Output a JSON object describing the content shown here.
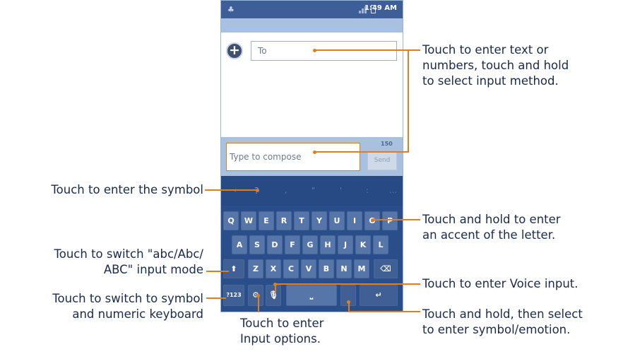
{
  "status_bar": {
    "time": "1:49 AM",
    "android_icon": "android-icon",
    "signal_icon": "signal-icon",
    "battery_icon": "battery-icon"
  },
  "recipient": {
    "add_icon": "add-contact-icon",
    "to_placeholder": "To"
  },
  "compose": {
    "placeholder": "Type to compose",
    "char_count": "150",
    "send_label": "Send"
  },
  "keyboard": {
    "symbol_row": [
      "←",
      "?",
      ",",
      "\"",
      "'",
      ":",
      "…"
    ],
    "row1": [
      "Q",
      "W",
      "E",
      "R",
      "T",
      "Y",
      "U",
      "I",
      "O",
      "P"
    ],
    "row2": [
      "A",
      "S",
      "D",
      "F",
      "G",
      "H",
      "J",
      "K",
      "L"
    ],
    "row3": [
      "Z",
      "X",
      "C",
      "V",
      "B",
      "N",
      "M"
    ],
    "shift_icon": "shift-icon",
    "backspace_icon": "backspace-icon",
    "numeric_key_label": "?123",
    "settings_icon": "settings-icon",
    "mic_icon": "mic-icon",
    "space_icon": "space-icon",
    "enter_icon": "enter-icon"
  },
  "callouts": {
    "input_method": [
      "Touch to enter text or",
      "numbers, touch and hold",
      "to select input method."
    ],
    "symbol": "Touch to enter the symbol",
    "accent": [
      "Touch and hold to enter",
      "an accent of the letter."
    ],
    "input_mode": [
      "Touch to switch \"abc/Abc/",
      "ABC\" input mode"
    ],
    "voice": "Touch to enter Voice input.",
    "numeric": [
      "Touch to switch to symbol",
      "and numeric keyboard"
    ],
    "options": [
      "Touch to enter",
      "Input options."
    ],
    "emotion": [
      "Touch and hold, then select",
      "to enter symbol/emotion."
    ]
  },
  "colors": {
    "accent": "#e07f1a",
    "keyboard": "#2a4e8a",
    "key": "#5675a8",
    "callout_text": "#1a2a4d"
  }
}
